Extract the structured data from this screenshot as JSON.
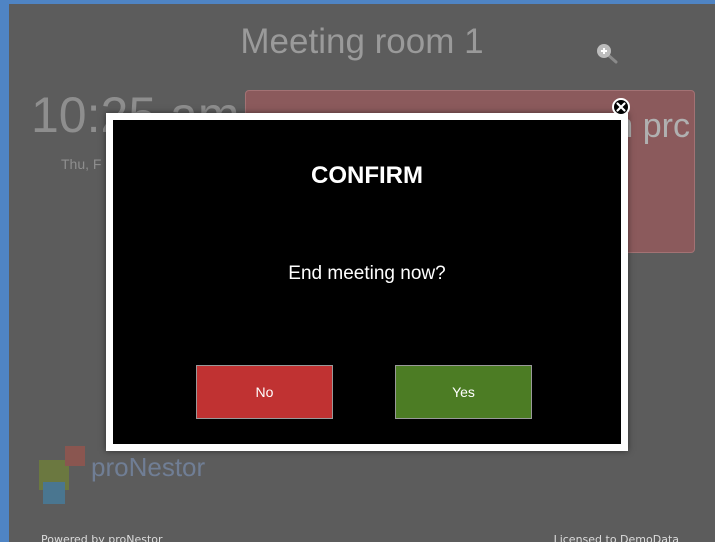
{
  "room": {
    "title": "Meeting room 1",
    "clock": "10:25 am",
    "date": "Thu, F"
  },
  "meeting": {
    "status_fragment": "n prc"
  },
  "brand": {
    "logo_text": "proNestor"
  },
  "footer": {
    "powered_by": "Powered by proNestor",
    "licensed_to": "Licensed to DemoData"
  },
  "dialog": {
    "title": "CONFIRM",
    "message": "End meeting now?",
    "no_label": "No",
    "yes_label": "Yes"
  },
  "colors": {
    "background": "#5c5c5c",
    "meeting_card": "#8b5a5c",
    "no_button": "#c03232",
    "yes_button": "#4c7c24",
    "frame": "#4f84c4"
  },
  "icons": {
    "zoom": "zoom-in-icon",
    "close": "close-icon"
  }
}
